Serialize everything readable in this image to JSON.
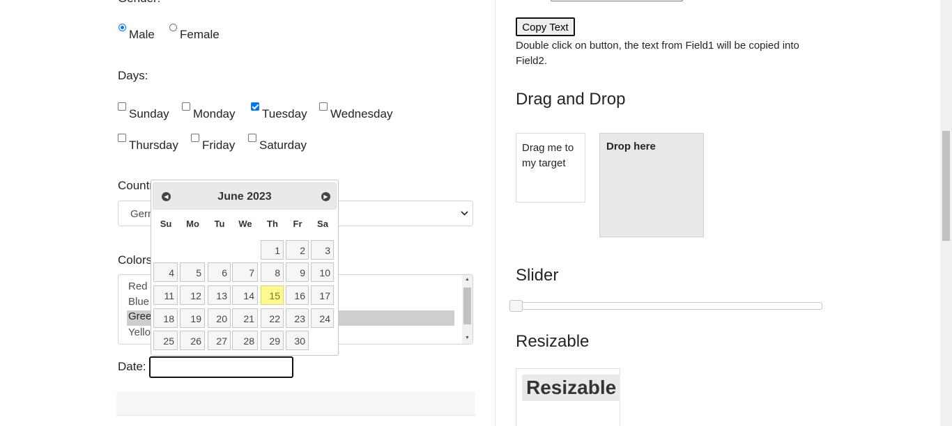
{
  "form": {
    "gender_label": "Gender:",
    "gender_options": [
      {
        "label": "Male",
        "checked": true
      },
      {
        "label": "Female",
        "checked": false
      }
    ],
    "days_label": "Days:",
    "days": [
      {
        "label": "Sunday",
        "checked": false
      },
      {
        "label": "Monday",
        "checked": false
      },
      {
        "label": "Tuesday",
        "checked": true
      },
      {
        "label": "Wednesday",
        "checked": false
      },
      {
        "label": "Thursday",
        "checked": false
      },
      {
        "label": "Friday",
        "checked": false
      },
      {
        "label": "Saturday",
        "checked": false
      }
    ],
    "country_label": "Country:",
    "country_value": "Germany",
    "colors_label": "Colors:",
    "colors_options": [
      "Red",
      "Blue",
      "Green",
      "Yellow"
    ],
    "colors_selected": "Green",
    "date_label": "Date:",
    "date_value": ""
  },
  "datepicker": {
    "title": "June 2023",
    "prev_icon": "circle-triangle-w",
    "next_icon": "circle-triangle-e",
    "weekdays": [
      "Su",
      "Mo",
      "Tu",
      "We",
      "Th",
      "Fr",
      "Sa"
    ],
    "weeks": [
      [
        "",
        "",
        "",
        "",
        "1",
        "2",
        "3"
      ],
      [
        "4",
        "5",
        "6",
        "7",
        "8",
        "9",
        "10"
      ],
      [
        "11",
        "12",
        "13",
        "14",
        "15",
        "16",
        "17"
      ],
      [
        "18",
        "19",
        "20",
        "21",
        "22",
        "23",
        "24"
      ],
      [
        "25",
        "26",
        "27",
        "28",
        "29",
        "30",
        ""
      ]
    ],
    "today": "15",
    "today_color": "#fffa90"
  },
  "right": {
    "copy_button": "Copy Text",
    "copy_note": "Double click on button, the text from Field1 will be copied into Field2.",
    "drag_drop_heading": "Drag and Drop",
    "draggable_text": "Drag me to my target",
    "droppable_text": "Drop here",
    "slider_heading": "Slider",
    "slider_value": 0,
    "resizable_heading": "Resizable",
    "resizable_text": "Resizable"
  }
}
